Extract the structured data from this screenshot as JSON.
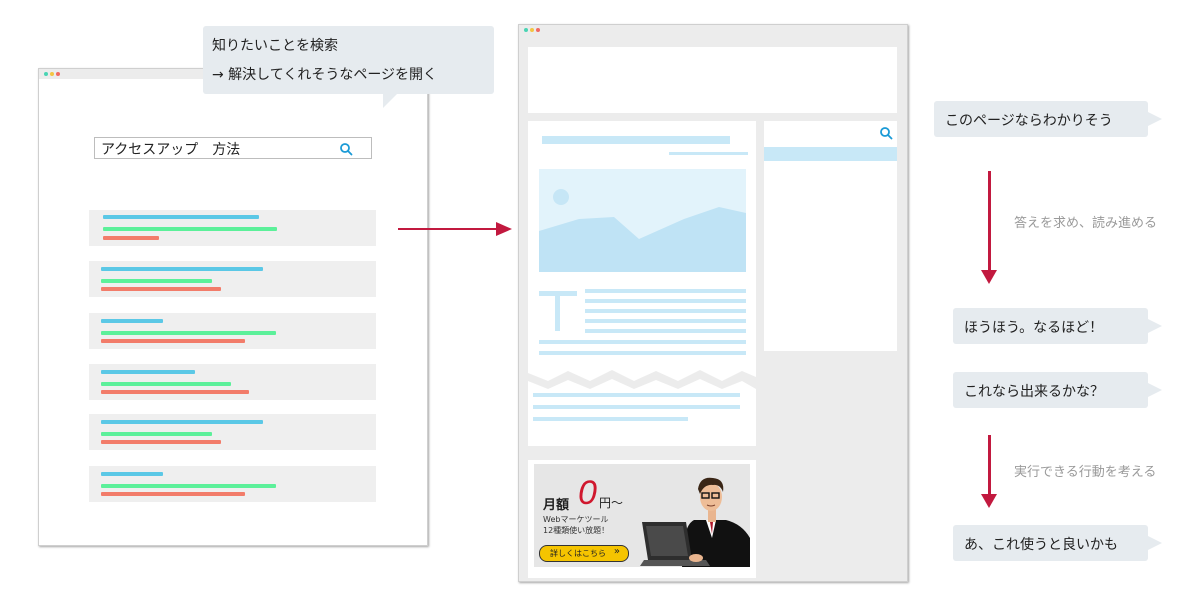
{
  "top_bubble": {
    "line1": "知りたいことを検索",
    "line2": "→ 解決してくれそうなページを開く"
  },
  "search_window": {
    "query": "アクセスアップ　方法"
  },
  "ad_banner": {
    "monthly_fee_label": "月額",
    "price_number": "0",
    "price_unit": "円〜",
    "tagline1": "Webマーケツール",
    "tagline2": "12種類使い放題！",
    "button_label": "詳しくはこちら",
    "button_chevron": "»"
  },
  "thoughts": {
    "t1": "このページならわかりそう",
    "note1": "答えを求め、読み進める",
    "t2": "ほうほう。なるほど！",
    "t3": "これなら出来るかな？",
    "note2": "実行できる行動を考える",
    "t4": "あ、これ使うと良いかも"
  },
  "colors": {
    "arrow": "#c2193f",
    "bubble_bg": "#e6ebef",
    "result_title": "#5bc8e6",
    "result_url": "#5cf09a",
    "result_desc": "#f27c6a",
    "article_blue": "#c8e8f7",
    "search_icon": "#1a9ad6",
    "ad_button": "#f5c400"
  },
  "icons": [
    "search-icon",
    "search-icon",
    "person-with-laptop-illustration",
    "image-placeholder-icon"
  ]
}
